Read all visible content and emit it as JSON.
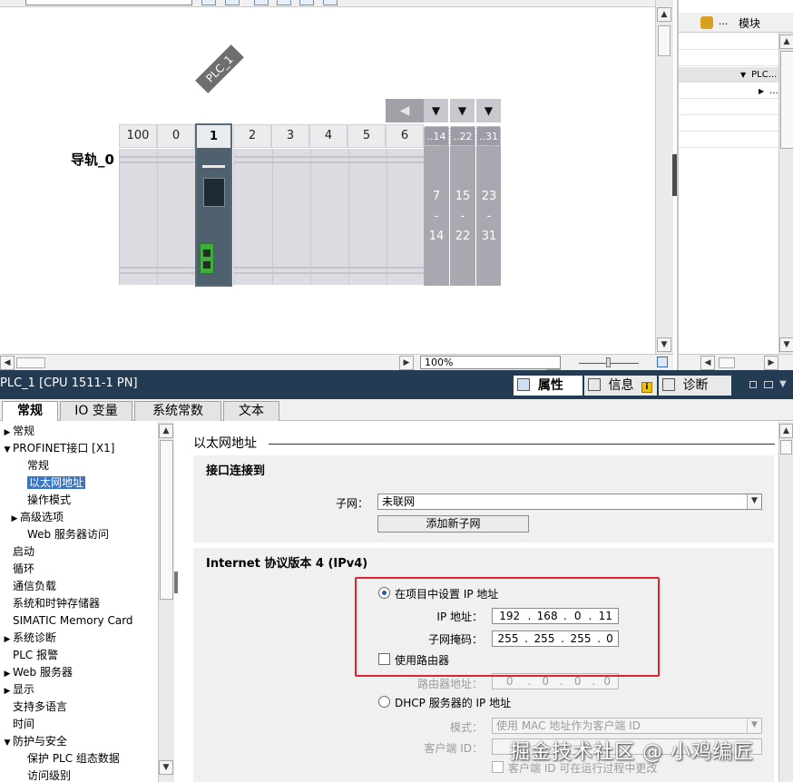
{
  "device_view": {
    "plc_tag": "PLC_1",
    "rack_label": "导轨_0",
    "slots": [
      "100",
      "0",
      "1",
      "2",
      "3",
      "4",
      "5",
      "6"
    ],
    "group_headers": [
      "..14",
      "..22",
      "..31"
    ],
    "group_ranges": [
      {
        "start": "7",
        "end": "14"
      },
      {
        "start": "15",
        "end": "22"
      },
      {
        "start": "23",
        "end": "31"
      }
    ],
    "zoom": "100%"
  },
  "overview": {
    "column_dots": "...",
    "column_module": "模块",
    "rows": [
      "PLC...",
      "..."
    ]
  },
  "inspector": {
    "title": "PLC_1 [CPU 1511-1 PN]",
    "tabs": {
      "properties": "属性",
      "info": "信息",
      "diagnostics": "诊断"
    },
    "prop_tabs": [
      "常规",
      "IO 变量",
      "系统常数",
      "文本"
    ]
  },
  "tree": [
    {
      "label": "常规",
      "indent": 0,
      "arrow": "right"
    },
    {
      "label": "PROFINET接口 [X1]",
      "indent": 0,
      "arrow": "down"
    },
    {
      "label": "常规",
      "indent": 2,
      "arrow": ""
    },
    {
      "label": "以太网地址",
      "indent": 2,
      "arrow": "",
      "selected": true
    },
    {
      "label": "操作模式",
      "indent": 2,
      "arrow": ""
    },
    {
      "label": "高级选项",
      "indent": 1,
      "arrow": "right"
    },
    {
      "label": "Web 服务器访问",
      "indent": 2,
      "arrow": ""
    },
    {
      "label": "启动",
      "indent": 0,
      "arrow": ""
    },
    {
      "label": "循环",
      "indent": 0,
      "arrow": ""
    },
    {
      "label": "通信负载",
      "indent": 0,
      "arrow": ""
    },
    {
      "label": "系统和时钟存储器",
      "indent": 0,
      "arrow": ""
    },
    {
      "label": "SIMATIC Memory Card",
      "indent": 0,
      "arrow": ""
    },
    {
      "label": "系统诊断",
      "indent": 0,
      "arrow": "right"
    },
    {
      "label": "PLC 报警",
      "indent": 0,
      "arrow": ""
    },
    {
      "label": "Web 服务器",
      "indent": 0,
      "arrow": "right"
    },
    {
      "label": "显示",
      "indent": 0,
      "arrow": "right"
    },
    {
      "label": "支持多语言",
      "indent": 0,
      "arrow": ""
    },
    {
      "label": "时间",
      "indent": 0,
      "arrow": ""
    },
    {
      "label": "防护与安全",
      "indent": 0,
      "arrow": "down"
    },
    {
      "label": "保护 PLC 组态数据",
      "indent": 2,
      "arrow": ""
    },
    {
      "label": "访问级别",
      "indent": 2,
      "arrow": ""
    }
  ],
  "content": {
    "header": "以太网地址",
    "interface": {
      "title": "接口连接到",
      "subnet_label": "子网：",
      "subnet_value": "未联网",
      "add_subnet_button": "添加新子网"
    },
    "ipv4": {
      "title": "Internet 协议版本 4 (IPv4)",
      "set_in_project": "在项目中设置 IP 地址",
      "ip_label": "IP 地址：",
      "ip": [
        "192",
        "168",
        "0",
        "11"
      ],
      "mask_label": "子网掩码：",
      "mask": [
        "255",
        "255",
        "255",
        "0"
      ],
      "use_router": "使用路由器",
      "router_label": "路由器地址：",
      "router": [
        "0",
        "0",
        "0",
        "0"
      ],
      "dhcp": "DHCP 服务器的 IP 地址",
      "mode_label": "模式：",
      "mode_value": "使用 MAC 地址作为客户端 ID",
      "client_id_label": "客户端 ID：",
      "client_id_change": "客户端 ID 可在运行过程中更改"
    }
  },
  "watermark": "掘金技术社区 @ 小鸡编匠"
}
